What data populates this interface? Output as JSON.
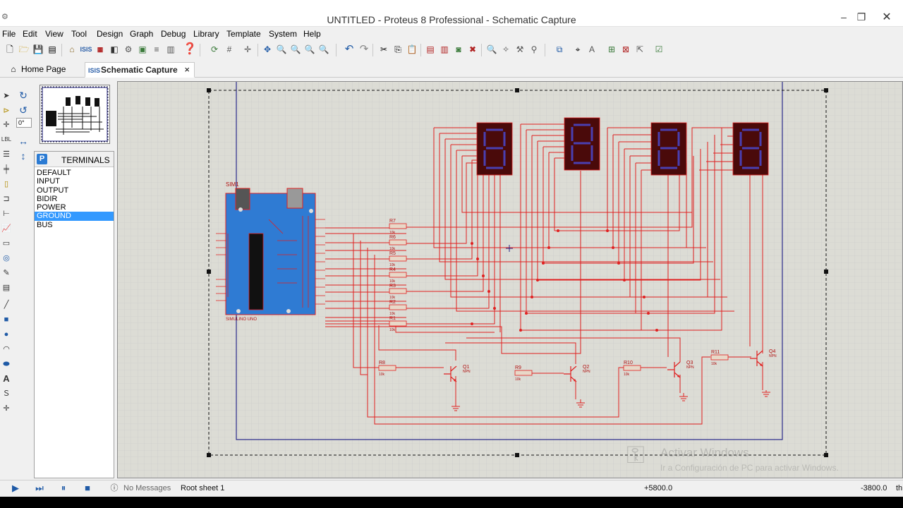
{
  "window": {
    "title": "UNTITLED - Proteus 8 Professional - Schematic Capture"
  },
  "menu": [
    "File",
    "Edit",
    "View",
    "Tool",
    "Design",
    "Graph",
    "Debug",
    "Library",
    "Template",
    "System",
    "Help"
  ],
  "tabs": [
    {
      "label": "Home Page",
      "icon": "home-icon"
    },
    {
      "label": "Schematic Capture",
      "icon": "schematic-icon",
      "close": "×"
    }
  ],
  "orientation": {
    "angle": "0°"
  },
  "terminals": {
    "picker": "P",
    "title": "TERMINALS",
    "items": [
      "DEFAULT",
      "INPUT",
      "OUTPUT",
      "BIDIR",
      "POWER",
      "GROUND",
      "BUS"
    ],
    "selected": "GROUND"
  },
  "schematic": {
    "arduino_ref": "SIM1",
    "arduino_name": "SIMULINO UNO",
    "resistors": [
      {
        "ref": "R7",
        "value": "10k"
      },
      {
        "ref": "R6",
        "value": "10k"
      },
      {
        "ref": "R5",
        "value": "10k"
      },
      {
        "ref": "R4",
        "value": "10k"
      },
      {
        "ref": "R3",
        "value": "10k"
      },
      {
        "ref": "R2",
        "value": "10k"
      },
      {
        "ref": "R1",
        "value": "10k"
      },
      {
        "ref": "R8",
        "value": "10k"
      },
      {
        "ref": "R9",
        "value": "10k"
      },
      {
        "ref": "R10",
        "value": "10k"
      },
      {
        "ref": "R11",
        "value": "10k"
      }
    ],
    "transistors": [
      {
        "ref": "Q1",
        "type": "NPN"
      },
      {
        "ref": "Q2",
        "type": "NPN"
      },
      {
        "ref": "Q3",
        "type": "NPN"
      },
      {
        "ref": "Q4",
        "type": "NPN"
      }
    ],
    "colors": {
      "wire": "#e02020",
      "display_body": "#4a0a0a",
      "segment": "#4a3fb0",
      "board": "#2f7bd3",
      "sheet_border": "#2a2a8a"
    }
  },
  "watermark": {
    "line1": "Activar Windows",
    "line2": "Ir a Configuración de PC para activar Windows."
  },
  "status": {
    "messages": "No Messages",
    "sheet": "Root sheet 1",
    "x": "+5800.0",
    "y": "-3800.0",
    "unit": "th"
  }
}
